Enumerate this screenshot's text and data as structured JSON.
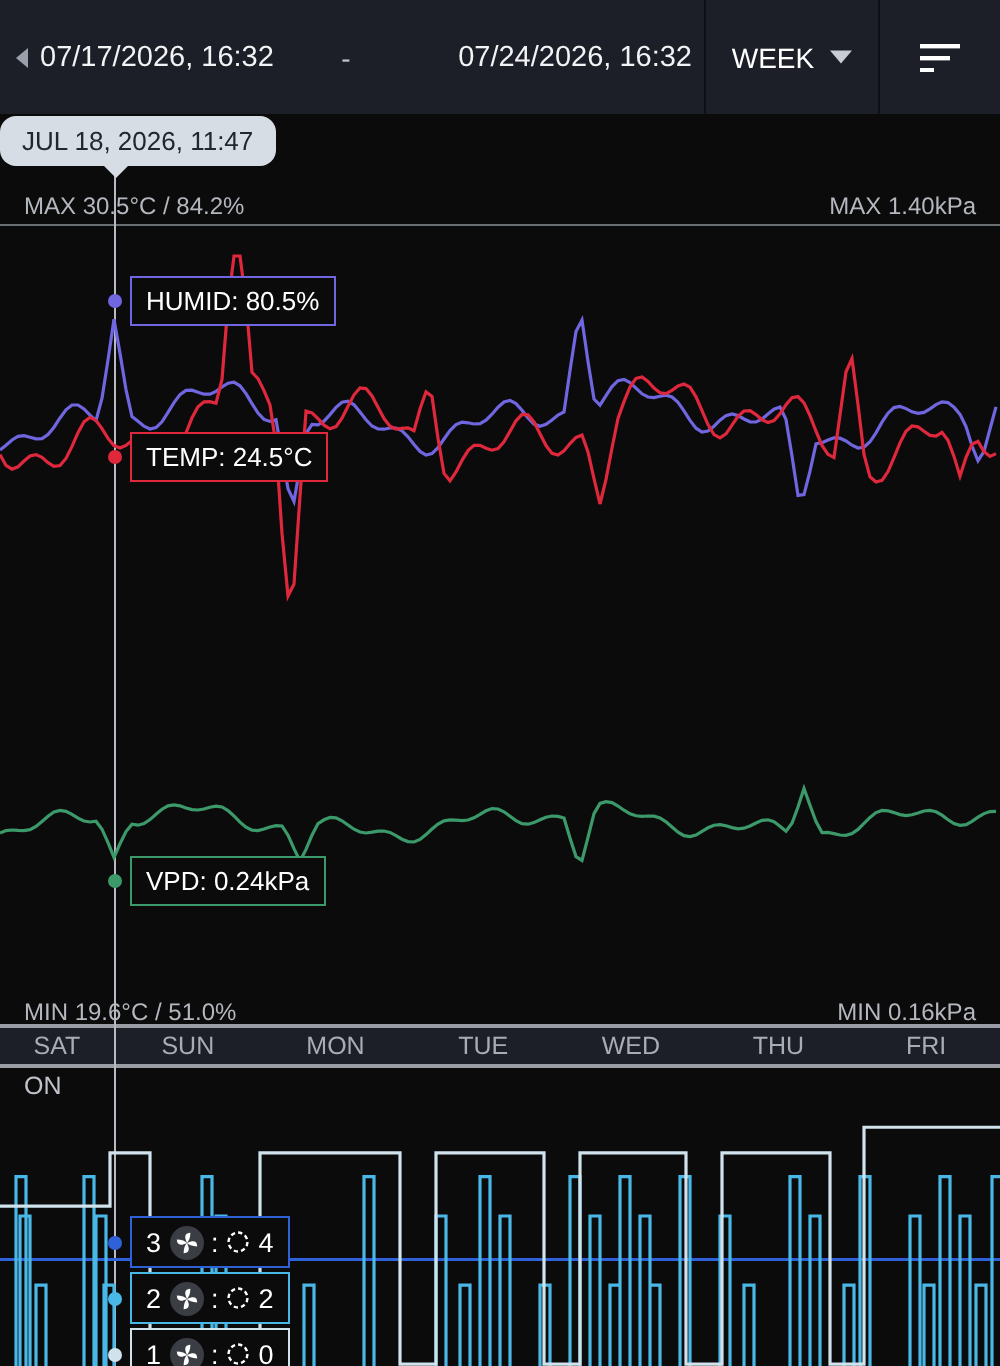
{
  "header": {
    "start": "07/17/2026, 16:32",
    "separator": "-",
    "end": "07/24/2026, 16:32",
    "period": "WEEK"
  },
  "cursor_time": "JUL 18, 2026, 11:47",
  "climate_chart": {
    "max_left": "MAX 30.5°C / 84.2%",
    "max_right": "MAX 1.40kPa",
    "min_left": "MIN 19.6°C / 51.0%",
    "min_right": "MIN 0.16kPa",
    "readouts": [
      {
        "kind": "humid",
        "label": "HUMID: 80.5%",
        "color": "#6f66e0"
      },
      {
        "kind": "temp",
        "label": "TEMP: 24.5°C",
        "color": "#e0283c"
      },
      {
        "kind": "vpd",
        "label": "VPD: 0.24kPa",
        "color": "#3c9a6a"
      }
    ]
  },
  "days": [
    "SAT",
    "SUN",
    "MON",
    "TUE",
    "WED",
    "THU",
    "FRI"
  ],
  "fan_chart": {
    "state": "ON",
    "readouts": [
      {
        "speed": "3",
        "separator": ":",
        "value": "4",
        "color": "#2f62d8"
      },
      {
        "speed": "2",
        "separator": ":",
        "value": "2",
        "color": "#4ab8e6"
      },
      {
        "speed": "1",
        "separator": ":",
        "value": "0",
        "color": "#d0e2ec"
      }
    ]
  }
}
